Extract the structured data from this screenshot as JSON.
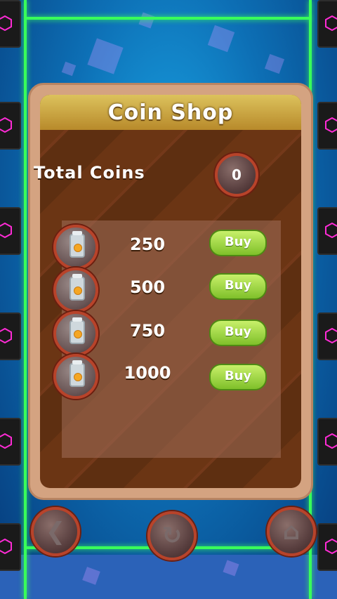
{
  "title": "Coin Shop",
  "total": {
    "label": "Total Coins",
    "value": "0"
  },
  "packages": [
    {
      "amount": "250",
      "buy_label": "Buy"
    },
    {
      "amount": "500",
      "buy_label": "Buy"
    },
    {
      "amount": "750",
      "buy_label": "Buy"
    },
    {
      "amount": "1000",
      "buy_label": "Buy"
    }
  ],
  "nav": {
    "back_icon": "back-arrow-icon",
    "restart_icon": "restart-icon",
    "home_icon": "home-icon"
  },
  "colors": {
    "accent_green": "#39ff5a",
    "panel_wood": "#6b3514",
    "button_green": "#7fc02a",
    "ring_red": "#b8432a"
  }
}
